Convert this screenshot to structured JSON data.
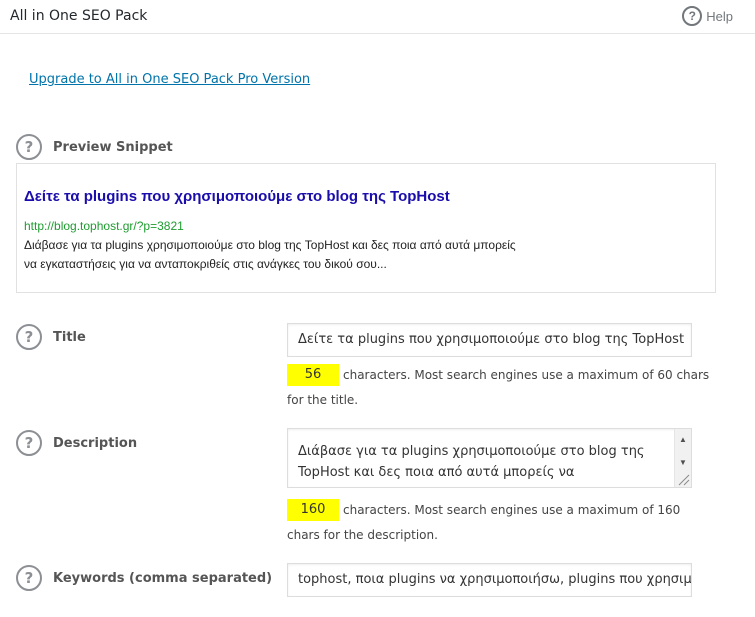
{
  "header": {
    "title": "All in One SEO Pack",
    "help_label": "Help",
    "help_icon": "question-circle-icon"
  },
  "upgrade_link": "Upgrade to All in One SEO Pack Pro Version",
  "preview": {
    "label": "Preview Snippet",
    "title": "Δείτε τα plugins που χρησιμοποιούμε στο blog της TopHost",
    "url": "http://blog.tophost.gr/?p=3821",
    "desc_line1": "Διάβασε για τα plugins χρησιμοποιούμε στο blog της TopHost και δες ποια από αυτά μπορείς",
    "desc_line2": "να εγκαταστήσεις για να ανταποκριθείς στις ανάγκες του δικού σου..."
  },
  "title_field": {
    "label": "Title",
    "value": "Δείτε τα plugins που χρησιμοποιούμε στο blog της TopHost",
    "count": "56",
    "hint_line1": "characters. Most search engines use a maximum of 60 chars",
    "hint_line2": "for the title."
  },
  "description_field": {
    "label": "Description",
    "line1": "Διάβασε για τα plugins χρησιμοποιούμε στο blog της",
    "line2": "TopHost και δες ποια από αυτά μπορείς να",
    "count": "160",
    "hint_line1": "characters. Most search engines use a maximum of 160",
    "hint_line2": "chars for the description."
  },
  "keywords_field": {
    "label": "Keywords (comma separated)",
    "value": "tophost, ποια plugins να χρησιμοποιήσω,  plugins που χρησιμοποιεί"
  },
  "colors": {
    "link": "#0073aa",
    "snippet_title": "#1a0dab",
    "snippet_url": "#1e9c2f",
    "counter_bg": "#ffff00"
  }
}
